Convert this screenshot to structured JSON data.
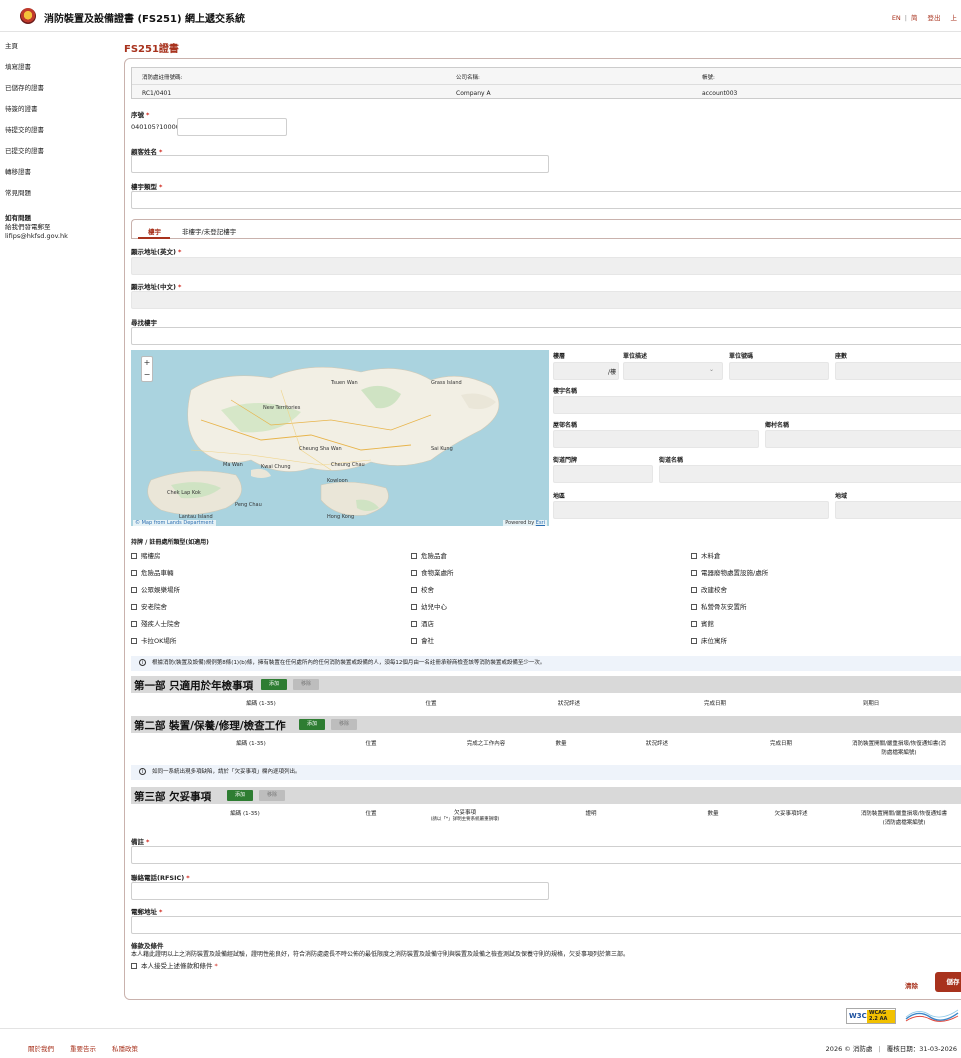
{
  "header": {
    "title": "消防裝置及設備證書 (FS251) 網上遞交系統",
    "lang_en": "EN",
    "lang_sep": "|",
    "lang_sc": "简",
    "logout": "登出",
    "user": "上"
  },
  "sidebar": {
    "items": [
      {
        "label": "主頁"
      },
      {
        "label": "填寫證書"
      },
      {
        "label": "已儲存的證書"
      },
      {
        "label": "待簽的證書"
      },
      {
        "label": "待提交的證書"
      },
      {
        "label": "已提交的證書"
      },
      {
        "label": "轉移證書"
      },
      {
        "label": "常見問題"
      }
    ],
    "help_title": "如有問題",
    "help_line1": "給我們發電郵至",
    "help_email": "lifips@hkfsd.gov.hk"
  },
  "page": {
    "title": "FS251證書"
  },
  "info": {
    "reg_label": "消防處註冊號碼:",
    "reg_value": "RC1/0401",
    "company_label": "公司名稱:",
    "company_value": "Company A",
    "account_label": "帳號:",
    "account_value": "account003"
  },
  "form": {
    "serial_label": "序號",
    "serial_prefix": "040105?10000",
    "customer_label": "顧客姓名",
    "building_type_label": "樓宇類型",
    "tab_building": "樓宇",
    "tab_other": "非樓宇/未登記樓宇",
    "addr_en_label": "顯示地址(英文)",
    "addr_zh_label": "顯示地址(中文)",
    "search_label": "尋找樓宇",
    "floor_label": "樓層",
    "floor_suffix": "/樓",
    "unit_desc_label": "單位描述",
    "unit_no_label": "單位號碼",
    "block_label": "座數",
    "building_name_label": "樓宇名稱",
    "estate_label": "屋邨名稱",
    "village_label": "鄉村名稱",
    "street_no_label": "街道門牌",
    "street_name_label": "街道名稱",
    "district_label": "地區",
    "region_label": "地域",
    "premises_label": "持牌 / 註冊處所類型(如適用)",
    "premises": [
      "賭樓房",
      "危險品倉",
      "木料倉",
      "危險品車輛",
      "食物業處所",
      "電器廢物處置設施/處所",
      "公眾娛樂場所",
      "校舍",
      "改建校舍",
      "安老院舍",
      "幼兒中心",
      "私營骨灰安置所",
      "殘疾人士院舍",
      "酒店",
      "賓館",
      "卡拉OK場所",
      "會社",
      "床位寓所"
    ],
    "notice1": "根據消防(裝置及設備)規例第8條(1)(b)條，擁有裝置在任何處所內的任何消防裝置或設備的人，須每12個月由一名註冊承辦商檢查該等消防裝置或設備至少一次。",
    "notice2": "如同一系統出現多項缺陷，請於「欠妥事項」欄內逐項列出。",
    "remarks_label": "備註",
    "phone_label": "聯絡電話(RFSIC)",
    "email_label": "電郵地址",
    "terms_title": "條款及條件",
    "terms_text": "本人藉此證明以上之消防裝置及設備經試驗，證明性能良好，符合消防處處長不時公佈的最低限度之消防裝置及設備守則與裝置及設備之檢查測試及保養守則的規格，欠妥事項列於第三部。",
    "accept_label": "本人接受上述條款和條件",
    "clear": "清除",
    "save": "儲存"
  },
  "sections": {
    "part1": {
      "title": "第一部 只適用於年檢事項",
      "add": "添加",
      "del": "移除",
      "cols": [
        "編碼 (1-35)",
        "位置",
        "狀況評述",
        "完成日期",
        "到期日"
      ]
    },
    "part2": {
      "title": "第二部 裝置/保養/修理/檢查工作",
      "add": "添加",
      "del": "移除",
      "cols": [
        "編碼 (1-35)",
        "位置",
        "完成之工作內容",
        "數量",
        "狀況評述",
        "完成日期",
        "消防裝置開關/嚴重損壞/恢復通知書(消",
        "防處檔案編號)"
      ]
    },
    "part3": {
      "title": "第三部 欠妥事項",
      "add": "添加",
      "del": "移除",
      "cols": [
        "編碼 (1-35)",
        "位置",
        "欠妥事項",
        "(請以「*」詳明主要系統嚴重損壞)",
        "證明",
        "數量",
        "欠妥事項評述",
        "消防裝置開關/嚴重損壞/恢復通知書",
        "(消防處檔案編號)"
      ]
    }
  },
  "map": {
    "attribution_left": "© Map from Lands Department",
    "attribution_right": "Powered by ",
    "attribution_link": "Esri",
    "places": [
      "New Territories",
      "Kowloon",
      "Hong Kong",
      "Lantau Island",
      "Peng Chau",
      "Cheung Chau",
      "Ma Wan",
      "Kwai Chung",
      "Sai Kung",
      "Grass Island",
      "Tsuen Wan",
      "Cheung Sha Wan",
      "Chek Lap Kok"
    ]
  },
  "footer": {
    "about": "關於我們",
    "notice": "重要告示",
    "privacy": "私隱政策",
    "copyright": "2026 © 消防處",
    "sep": "|",
    "revision": "覆核日期：31-03-2026",
    "wcag_w3c": "W3C",
    "wcag_badge_1": "WCAG",
    "wcag_badge_2": "2.2 AA"
  },
  "colors": {
    "brand": "#a8321d",
    "add_button": "#2e7d32",
    "section_bg": "#d9d9d9",
    "required": "#d0271c"
  }
}
